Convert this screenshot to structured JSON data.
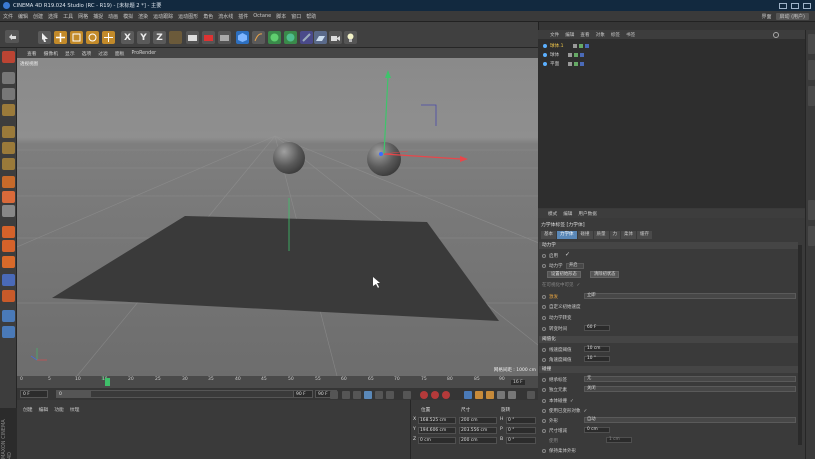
{
  "window": {
    "title": "CINEMA 4D R19.024 Studio (RC - R19) - [未标题 2 *] - 主要"
  },
  "menubar": {
    "items": [
      "文件",
      "编辑",
      "创建",
      "选择",
      "工具",
      "网格",
      "捕捉",
      "动画",
      "模拟",
      "渲染",
      "运动跟踪",
      "运动图形",
      "角色",
      "流水线",
      "插件",
      "Octane",
      "脚本",
      "窗口",
      "帮助"
    ],
    "layout_label": "界面",
    "layout_value": "启动 (用户)"
  },
  "toolbar": {
    "axis_x": "X",
    "axis_y": "Y",
    "axis_z": "Z"
  },
  "viewport": {
    "menu": [
      "查看",
      "摄像机",
      "显示",
      "选项",
      "过滤",
      "面板",
      "ProRender"
    ],
    "label": "透视视图",
    "grid_scale": "网格间距 : 1000 cm"
  },
  "timeline": {
    "ticks": [
      "0",
      "5",
      "10",
      "15",
      "20",
      "25",
      "30",
      "35",
      "40",
      "45",
      "50",
      "55",
      "60",
      "65",
      "70",
      "75",
      "80",
      "85",
      "90"
    ],
    "current_marker": "13",
    "end_frame_readout": "16 F",
    "start_field": "0 F",
    "start_field2": "0",
    "end_field": "90 F",
    "end_field2": "90 F",
    "progress": 0.144
  },
  "material_manager": {
    "tabs": [
      "创建",
      "编辑",
      "功能",
      "纹理"
    ]
  },
  "coords": {
    "headers": [
      "位置",
      "尺寸",
      "旋转"
    ],
    "rows": [
      {
        "axis": "X",
        "pos": "168.525 cm",
        "size": "200 cm",
        "rot_axis": "H",
        "rot": "0 °"
      },
      {
        "axis": "Y",
        "pos": "194.606 cm",
        "size": "203.556 cm",
        "rot_axis": "P",
        "rot": "0 °"
      },
      {
        "axis": "Z",
        "pos": "0 cm",
        "size": "200 cm",
        "rot_axis": "B",
        "rot": "0 °"
      }
    ]
  },
  "object_manager": {
    "menu": [
      "文件",
      "编辑",
      "查看",
      "对象",
      "标签",
      "书签"
    ],
    "objects": [
      {
        "name": "球体.1",
        "color": "#5bb0ff"
      },
      {
        "name": "球体",
        "color": "#5bb0ff"
      },
      {
        "name": "平面",
        "color": "#5bb0ff"
      }
    ]
  },
  "attributes": {
    "menu": [
      "模式",
      "编辑",
      "用户数据"
    ],
    "title": "力学体标签 [力学体]",
    "tabs": [
      {
        "label": "基本",
        "active": false
      },
      {
        "label": "力学体",
        "active": true
      },
      {
        "label": "碰撞",
        "active": false
      },
      {
        "label": "质量",
        "active": false
      },
      {
        "label": "力",
        "active": false
      },
      {
        "label": "柔体",
        "active": false
      },
      {
        "label": "缓存",
        "active": false
      }
    ],
    "section_dynamics": "动力学",
    "enabled_label": "启用",
    "enabled_check": "✓",
    "dynamics_label": "动力学",
    "dynamics_value": "开启",
    "btn_set_initial": "设置初始形态",
    "btn_clear_initial": "清除初状态",
    "viewport_show": "在可视化中可见",
    "trigger_label": "激发",
    "trigger_value": "立即",
    "custom_init_vel": "自定义初始速度",
    "dynamics_transition": "动力学转变",
    "transition_time_label": "转变时间",
    "transition_time_value": "60 F",
    "section_threshold": "阈值化",
    "linear_threshold_label": "线速度阈值",
    "linear_threshold_value": "10 cm",
    "angular_threshold_label": "角速度阈值",
    "angular_threshold_value": "10 °",
    "section_collision": "碰撞",
    "inherit_tag_label": "继承标签",
    "inherit_tag_value": "无",
    "individual_elements_label": "独立元素",
    "individual_elements_value": "关闭",
    "self_collision_label": "本体碰撞",
    "use_deformed_label": "使用已变形对象",
    "shape_label": "外形",
    "shape_value": "自动",
    "size_increment_label": "尺寸增减",
    "size_increment_value": "0 cm",
    "margin_label": "使用",
    "margin_value": "1 cm",
    "keep_soft_label": "保持柔体外形"
  },
  "brand": "MAXON CINEMA 4D"
}
